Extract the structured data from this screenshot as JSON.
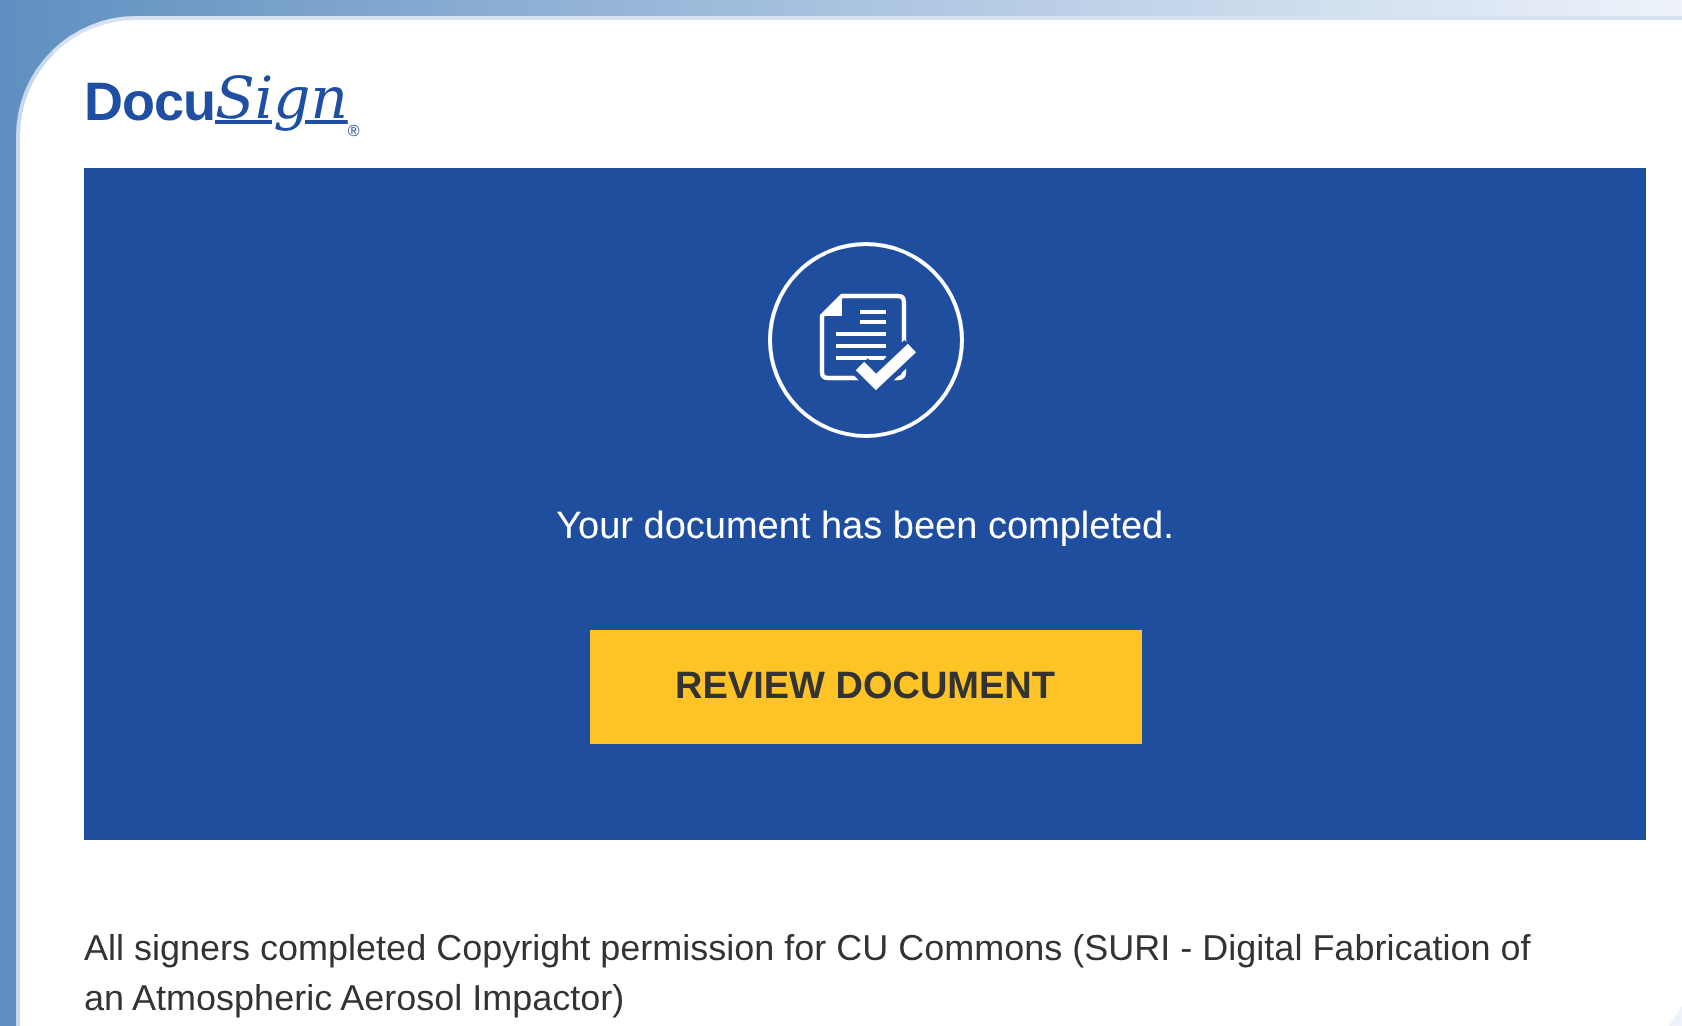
{
  "logo": {
    "main": "Docu",
    "script": "Sign",
    "mark": "®"
  },
  "banner": {
    "message": "Your document has been completed.",
    "button": "REVIEW DOCUMENT"
  },
  "body_text": "All signers completed Copyright permission for CU Commons (SURI - Digital Fabrication of an Atmospheric Aerosol Impactor)"
}
